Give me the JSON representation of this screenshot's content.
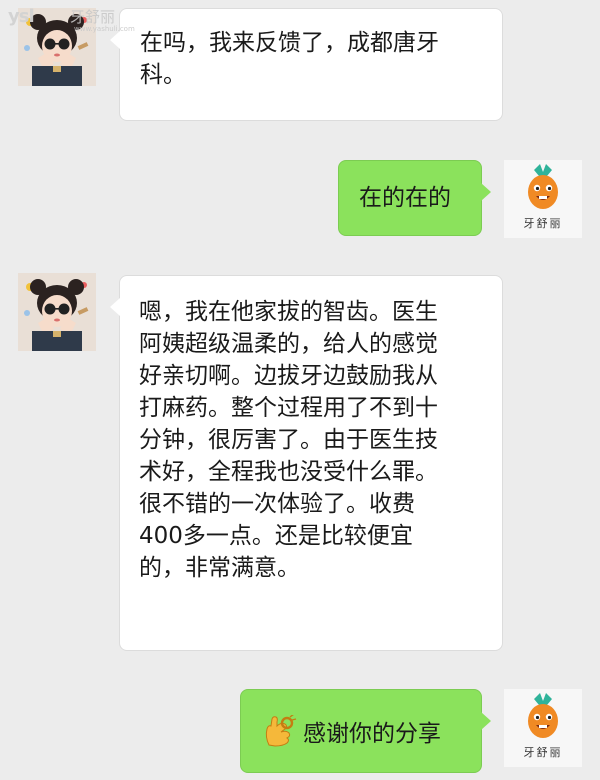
{
  "watermark": {
    "logo": "ysl",
    "site_name": "牙舒丽",
    "url": "www.yashuli.com"
  },
  "brand": {
    "name": "牙舒丽",
    "icon": "carrot-mascot-icon"
  },
  "colors": {
    "background": "#ececec",
    "incoming_bubble": "#ffffff",
    "outgoing_bubble": "#8be25c"
  },
  "messages": [
    {
      "sender": "customer",
      "text": "在吗，我来反馈了，成都唐牙\n科。"
    },
    {
      "sender": "clinic",
      "text": "在的在的"
    },
    {
      "sender": "customer",
      "text": "嗯，我在他家拔的智齿。医生\n阿姨超级温柔的，给人的感觉\n好亲切啊。边拔牙边鼓励我从\n打麻药。整个过程用了不到十\n分钟，很厉害了。由于医生技\n术好，全程我也没受什么罪。\n很不错的一次体验了。收费\n400多一点。还是比较便宜\n的，非常满意。"
    },
    {
      "sender": "clinic",
      "emoji": "ok-hand-icon",
      "text": "感谢你的分享"
    }
  ]
}
